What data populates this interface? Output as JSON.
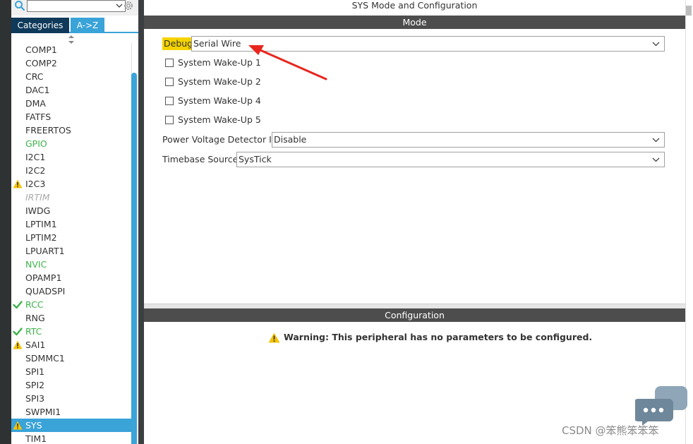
{
  "search": {
    "placeholder": ""
  },
  "tabs": [
    {
      "label": "Categories"
    },
    {
      "label": "A->Z"
    }
  ],
  "peripherals": [
    {
      "label": "COMP1",
      "state": "normal"
    },
    {
      "label": "COMP2",
      "state": "normal"
    },
    {
      "label": "CRC",
      "state": "normal"
    },
    {
      "label": "DAC1",
      "state": "normal"
    },
    {
      "label": "DMA",
      "state": "normal"
    },
    {
      "label": "FATFS",
      "state": "normal"
    },
    {
      "label": "FREERTOS",
      "state": "normal"
    },
    {
      "label": "GPIO",
      "state": "green"
    },
    {
      "label": "I2C1",
      "state": "normal"
    },
    {
      "label": "I2C2",
      "state": "normal"
    },
    {
      "label": "I2C3",
      "state": "warning"
    },
    {
      "label": "IRTIM",
      "state": "disabled"
    },
    {
      "label": "IWDG",
      "state": "normal"
    },
    {
      "label": "LPTIM1",
      "state": "normal"
    },
    {
      "label": "LPTIM2",
      "state": "normal"
    },
    {
      "label": "LPUART1",
      "state": "normal"
    },
    {
      "label": "NVIC",
      "state": "green"
    },
    {
      "label": "OPAMP1",
      "state": "normal"
    },
    {
      "label": "QUADSPI",
      "state": "normal"
    },
    {
      "label": "RCC",
      "state": "check"
    },
    {
      "label": "RNG",
      "state": "normal"
    },
    {
      "label": "RTC",
      "state": "check"
    },
    {
      "label": "SAI1",
      "state": "warning"
    },
    {
      "label": "SDMMC1",
      "state": "normal"
    },
    {
      "label": "SPI1",
      "state": "normal"
    },
    {
      "label": "SPI2",
      "state": "normal"
    },
    {
      "label": "SPI3",
      "state": "normal"
    },
    {
      "label": "SWPMI1",
      "state": "normal"
    },
    {
      "label": "SYS",
      "state": "selected-warning"
    },
    {
      "label": "TIM1",
      "state": "normal"
    }
  ],
  "main": {
    "title": "SYS Mode and Configuration",
    "mode_header": "Mode",
    "config_header": "Configuration",
    "debug": {
      "label": "Debug",
      "value": "Serial Wire"
    },
    "wakeups": [
      {
        "label": "System Wake-Up 1",
        "checked": false
      },
      {
        "label": "System Wake-Up 2",
        "checked": false
      },
      {
        "label": "System Wake-Up 4",
        "checked": false
      },
      {
        "label": "System Wake-Up 5",
        "checked": false
      }
    ],
    "pvd": {
      "label": "Power Voltage Detector In",
      "value": "Disable"
    },
    "timebase": {
      "label": "Timebase Source",
      "value": "SysTick"
    },
    "warning": "Warning: This peripheral has no parameters to be configured."
  },
  "watermark": "CSDN @笨熊笨笨笨",
  "colors": {
    "accent": "#3aa3d8",
    "tab_dark": "#0f3a5a",
    "header_bar": "#4d4d4d",
    "ok_green": "#3db34a",
    "warn_yellow": "#f5d300",
    "annotation_red": "#e8261e"
  },
  "icons": {
    "search": "search-icon",
    "settings": "gear-icon",
    "dropdown": "chevron-down-icon",
    "warning": "warning-triangle-icon",
    "check": "checkmark-icon"
  }
}
